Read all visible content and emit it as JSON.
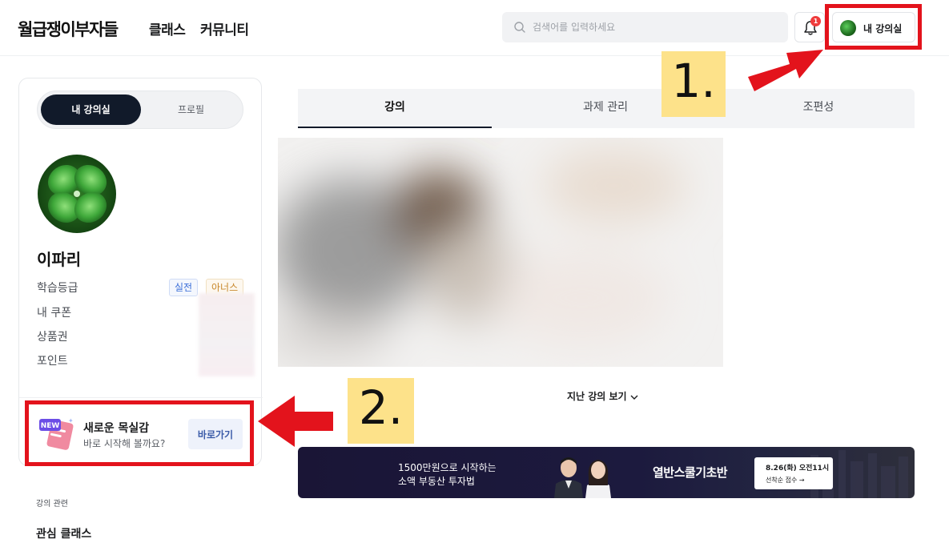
{
  "header": {
    "logo": "월급쟁이부자들",
    "nav": [
      "클래스",
      "커뮤니티"
    ],
    "search_placeholder": "검색어를 입력하세요",
    "notification_count": "1",
    "my_class_label": "내 강의실"
  },
  "sidebar": {
    "toggle": {
      "active": "내 강의실",
      "inactive": "프로필"
    },
    "user_name": "이파리",
    "rows": [
      "학습등급",
      "내 쿠폰",
      "상품권",
      "포인트"
    ],
    "tags": [
      "실전",
      "아너스"
    ],
    "promo": {
      "badge": "NEW",
      "title": "새로운 목실감",
      "subtitle": "바로 시작해 볼까요?",
      "button": "바로가기"
    },
    "section_label": "강의 관련",
    "section_item": "관심 클래스"
  },
  "main": {
    "tabs": [
      "강의",
      "과제 관리",
      "조편성"
    ],
    "past_link": "지난 강의 보기",
    "banner": {
      "line1": "1500만원으로 시작하는",
      "line2": "소액 부동산 투자법",
      "title": "열반스쿨기초반",
      "cta_date": "8.26(화) 오전11시",
      "cta_sub": "선착순 접수 →"
    }
  },
  "annotations": {
    "label_1": "1.",
    "label_2": "2.",
    "color": "#e3131c",
    "label_bg": "#fde28a"
  }
}
